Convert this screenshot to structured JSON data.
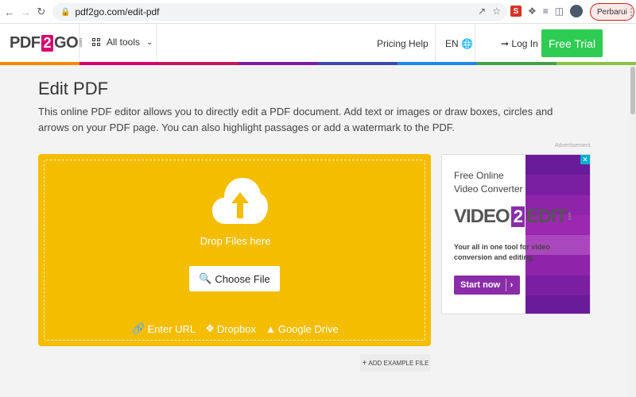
{
  "browser": {
    "url": "pdf2go.com/edit-pdf",
    "update_label": "Perbarui"
  },
  "header": {
    "logo_pre": "PDF",
    "logo_two": "2",
    "logo_post": "GO",
    "logo_com": ".com",
    "all_tools": "All tools",
    "pricing": "Pricing",
    "help": "Help",
    "language": "EN",
    "login": "Log In",
    "trial": "Free Trial",
    "trial_color": "#2ecc52"
  },
  "rainbow_colors": [
    "#f08a00",
    "#d6006e",
    "#c2185b",
    "#7b1fa2",
    "#3949ab",
    "#1e88e5",
    "#43a047",
    "#8bc34a"
  ],
  "main": {
    "title": "Edit PDF",
    "description": "This online PDF editor allows you to directly edit a PDF document. Add text or images or draw boxes, circles and arrows on your PDF page. You can also highlight passages or add a watermark to the PDF."
  },
  "uploader": {
    "drop_text": "Drop Files here",
    "choose_file": "Choose File",
    "enter_url": "Enter URL",
    "dropbox": "Dropbox",
    "google_drive": "Google Drive",
    "add_example": "ADD EXAMPLE FILE",
    "accent": "#f5bd00"
  },
  "ad": {
    "label": "Advertisement",
    "headline_1": "Free Online",
    "headline_2": "Video Converter",
    "brand_pre": "VIDEO",
    "brand_two": "2",
    "brand_post": "EDIT",
    "brand_com": ".com",
    "sub_1": "Your all in one tool for video",
    "sub_2": "conversion and editing.",
    "cta": "Start now",
    "stripe_colors": [
      "#6a1b9a",
      "#7b1fa2",
      "#8e24aa",
      "#9c27b0",
      "#ab47bc",
      "#8e24aa",
      "#7b1fa2",
      "#6a1b9a"
    ]
  }
}
